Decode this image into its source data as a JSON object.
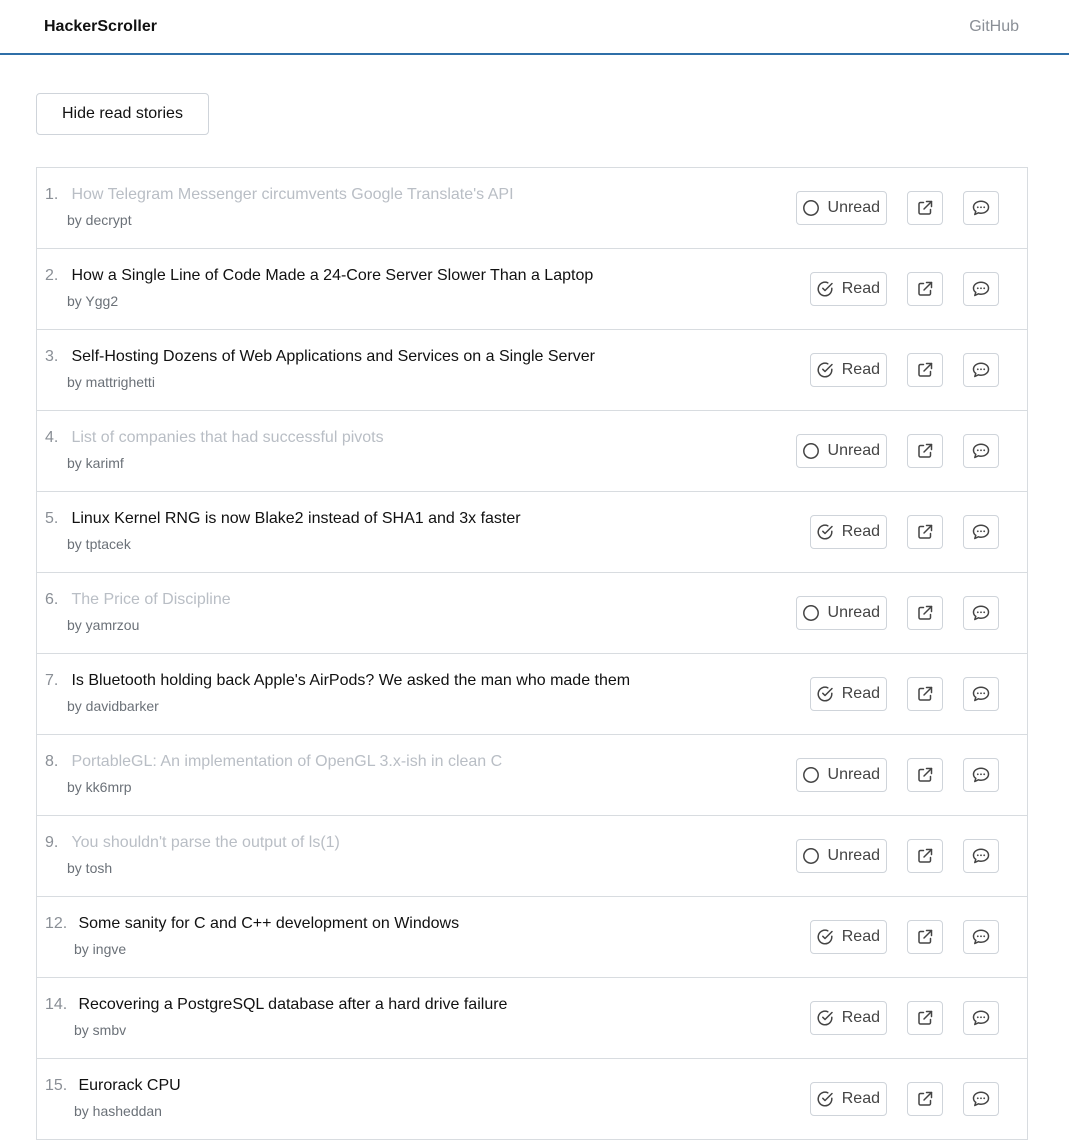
{
  "header": {
    "brand": "HackerScroller",
    "github": "GitHub"
  },
  "controls": {
    "hide_read_label": "Hide read stories"
  },
  "stories": [
    {
      "num": "1.",
      "title": "How Telegram Messenger circumvents Google Translate's API",
      "by": "by decrypt",
      "status": "Unread"
    },
    {
      "num": "2.",
      "title": "How a Single Line of Code Made a 24-Core Server Slower Than a Laptop",
      "by": "by Ygg2",
      "status": "Read"
    },
    {
      "num": "3.",
      "title": "Self-Hosting Dozens of Web Applications and Services on a Single Server",
      "by": "by mattrighetti",
      "status": "Read"
    },
    {
      "num": "4.",
      "title": "List of companies that had successful pivots",
      "by": "by karimf",
      "status": "Unread"
    },
    {
      "num": "5.",
      "title": "Linux Kernel RNG is now Blake2 instead of SHA1 and 3x faster",
      "by": "by tptacek",
      "status": "Read"
    },
    {
      "num": "6.",
      "title": "The Price of Discipline",
      "by": "by yamrzou",
      "status": "Unread"
    },
    {
      "num": "7.",
      "title": "Is Bluetooth holding back Apple's AirPods? We asked the man who made them",
      "by": "by davidbarker",
      "status": "Read"
    },
    {
      "num": "8.",
      "title": "PortableGL: An implementation of OpenGL 3.x-ish in clean C",
      "by": "by kk6mrp",
      "status": "Unread"
    },
    {
      "num": "9.",
      "title": "You shouldn't parse the output of ls(1)",
      "by": "by tosh",
      "status": "Unread"
    },
    {
      "num": "12.",
      "title": "Some sanity for C and C++ development on Windows",
      "by": "by ingve",
      "status": "Read"
    },
    {
      "num": "14.",
      "title": "Recovering a PostgreSQL database after a hard drive failure",
      "by": "by smbv",
      "status": "Read"
    },
    {
      "num": "15.",
      "title": "Eurorack CPU",
      "by": "by hasheddan",
      "status": "Read"
    }
  ]
}
